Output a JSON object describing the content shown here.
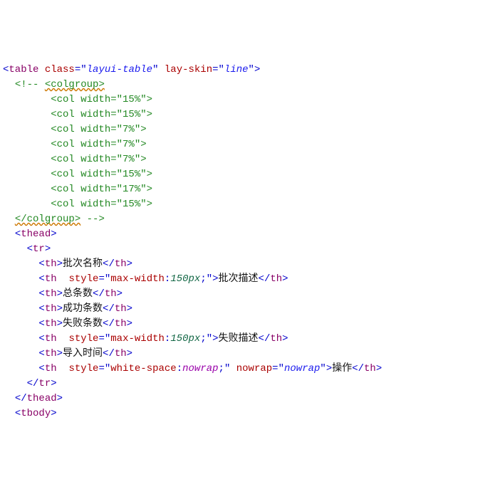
{
  "lines": {
    "l1_lt1": "<",
    "l1_tag": "table",
    "l1_sp": " ",
    "l1_an1": "class",
    "l1_eq1": "=",
    "l1_q1": "\"",
    "l1_av1": "layui-table",
    "l1_q2": "\"",
    "l1_sp2": " ",
    "l1_an2": "lay-skin",
    "l1_eq2": "=",
    "l1_q3": "\"",
    "l1_av2": "line",
    "l1_q4": "\"",
    "l1_gt": ">",
    "l2_cmt_open": "<!-- ",
    "l2_wavy": "<colgroup>",
    "l3": "<col width=\"15%\">",
    "l4": "<col width=\"15%\">",
    "l5": "<col width=\"7%\">",
    "l6": "<col width=\"7%\">",
    "l7": "<col width=\"7%\">",
    "l8": "<col width=\"15%\">",
    "l9": "<col width=\"17%\">",
    "l10": "<col width=\"15%\">",
    "l11_wavy": "</colgroup>",
    "l11_cmt_close": " -->",
    "l12_lt": "<",
    "l12_tag": "thead",
    "l12_gt": ">",
    "l13_lt": "<",
    "l13_tag": "tr",
    "l13_gt": ">",
    "th_open_lt": "<",
    "th_open_tag": "th",
    "th_open_gt": ">",
    "th_close_lt": "</",
    "th_close_tag": "th",
    "th_close_gt": ">",
    "th1_txt": "批次名称",
    "th2_an": "style",
    "th2_eq": "=",
    "th2_q": "\"",
    "th2_prop": "max-width",
    "th2_colon": ":",
    "th2_num": "150px",
    "th2_semi": ";",
    "th2_q2": "\"",
    "th2_txt": "批次描述",
    "th3_txt": "总条数",
    "th4_txt": "成功条数",
    "th5_txt": "失败条数",
    "th6_txt": "失败描述",
    "th7_txt": "导入时间",
    "th8_prop": "white-space",
    "th8_val": "nowrap",
    "th8_an2": "nowrap",
    "th8_av2": "nowrap",
    "th8_txt": "操作",
    "l_tr_close_lt": "</",
    "l_tr_close_tag": "tr",
    "l_tr_close_gt": ">",
    "l_thead_close_lt": "</",
    "l_thead_close_tag": "thead",
    "l_thead_close_gt": ">",
    "l_tbody_lt": "<",
    "l_tbody_tag": "tbody",
    "l_tbody_gt": ">"
  }
}
